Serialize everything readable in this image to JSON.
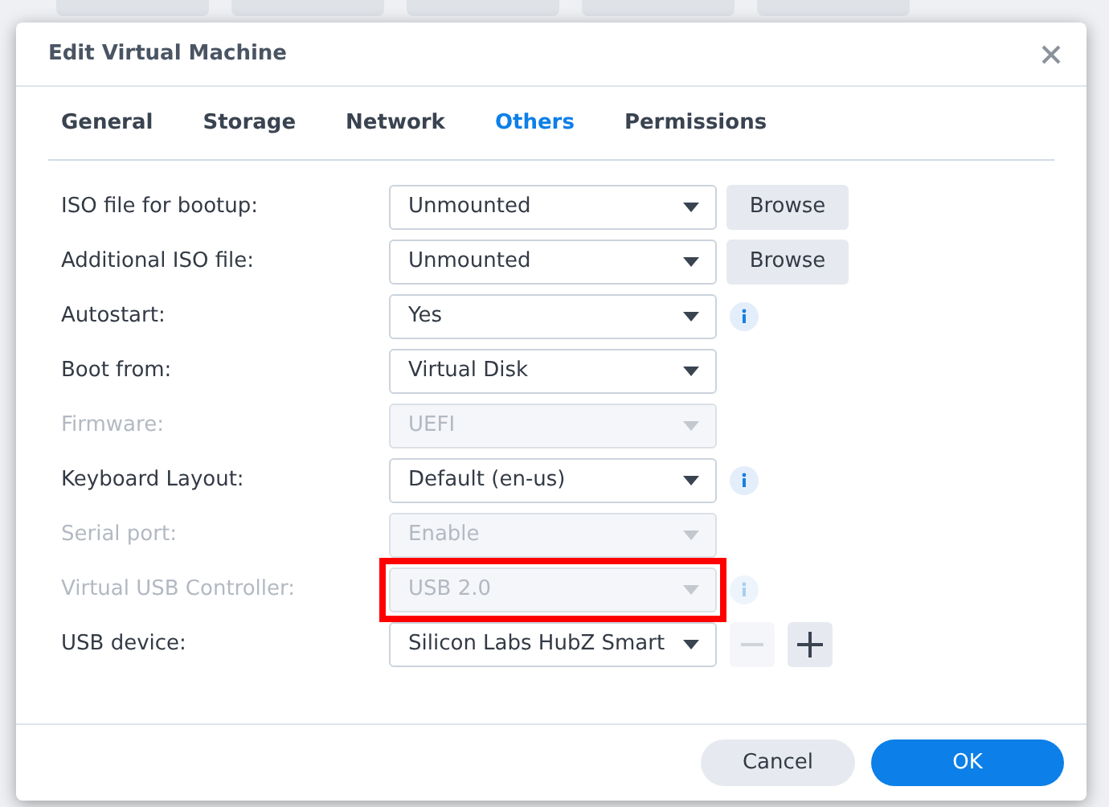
{
  "dialog": {
    "title": "Edit Virtual Machine"
  },
  "tabs": [
    {
      "label": "General",
      "selected": false
    },
    {
      "label": "Storage",
      "selected": false
    },
    {
      "label": "Network",
      "selected": false
    },
    {
      "label": "Others",
      "selected": true
    },
    {
      "label": "Permissions",
      "selected": false
    }
  ],
  "rows": [
    {
      "kind": "browse",
      "label": "ISO file for bootup:",
      "value": "Unmounted",
      "disabled": false,
      "highlighted": false,
      "button": "Browse"
    },
    {
      "kind": "browse",
      "label": "Additional ISO file:",
      "value": "Unmounted",
      "disabled": false,
      "highlighted": false,
      "button": "Browse"
    },
    {
      "kind": "info",
      "label": "Autostart:",
      "value": "Yes",
      "disabled": false,
      "highlighted": false
    },
    {
      "kind": "plain",
      "label": "Boot from:",
      "value": "Virtual Disk",
      "disabled": false,
      "highlighted": false
    },
    {
      "kind": "plain",
      "label": "Firmware:",
      "value": "UEFI",
      "disabled": true,
      "highlighted": false
    },
    {
      "kind": "info",
      "label": "Keyboard Layout:",
      "value": "Default (en-us)",
      "disabled": false,
      "highlighted": false
    },
    {
      "kind": "plain",
      "label": "Serial port:",
      "value": "Enable",
      "disabled": true,
      "highlighted": false
    },
    {
      "kind": "info",
      "label": "Virtual USB Controller:",
      "value": "USB 2.0",
      "disabled": true,
      "highlighted": true
    },
    {
      "kind": "add-remove",
      "label": "USB device:",
      "value": "Silicon Labs HubZ Smart",
      "disabled": false,
      "highlighted": false,
      "remove_disabled": true
    }
  ],
  "footer": {
    "cancel": "Cancel",
    "ok": "OK"
  }
}
